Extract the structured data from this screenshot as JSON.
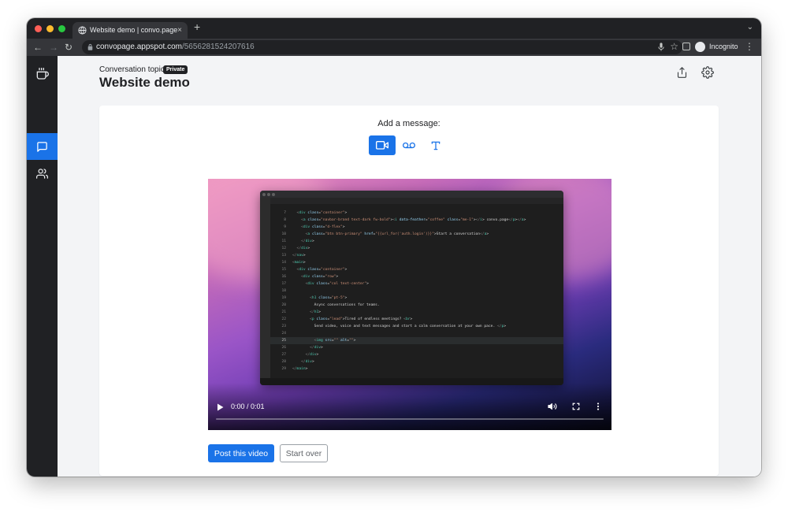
{
  "browser": {
    "tab_title": "Website demo | convo.page",
    "tab_close": "×",
    "new_tab": "+",
    "tab_search": "⌄",
    "url_host": "convopage.appspot.com",
    "url_path": "/5656281524207616",
    "profile_label": "Incognito",
    "menu": "⋮",
    "star": "☆",
    "back": "←",
    "forward": "→",
    "reload": "↻",
    "traffic_colors": [
      "#ff5f57",
      "#febc2e",
      "#28c840"
    ]
  },
  "app": {
    "logo": "coffee-cup-icon",
    "sidebar": [
      {
        "icon": "message-square-icon",
        "active": true
      },
      {
        "icon": "users-icon",
        "active": false
      }
    ],
    "header": {
      "topic_label": "Conversation topic:",
      "badge": "Private",
      "title": "Website demo"
    },
    "composer": {
      "add_label": "Add a message:",
      "modes": [
        {
          "icon": "video-icon",
          "active": true
        },
        {
          "icon": "voicemail-icon",
          "active": false
        },
        {
          "icon": "type-icon",
          "active": false
        }
      ],
      "video": {
        "time": "0:00 / 0:01",
        "code_lines": [
          {
            "n": "7",
            "code": "  <div class=\"container\">"
          },
          {
            "n": "8",
            "code": "    <a class=\"navbar-brand text-dark fw-bold\"><i data-feather=\"coffee\" class=\"me-1\"></i> convo.page</p></a>"
          },
          {
            "n": "9",
            "code": "    <div class=\"d-flex\">"
          },
          {
            "n": "10",
            "code": "      <a class=\"btn btn-primary\" href=\"{{url_for('auth.login')}}\">Start a conversation</a>"
          },
          {
            "n": "11",
            "code": "    </div>"
          },
          {
            "n": "12",
            "code": "  </div>"
          },
          {
            "n": "13",
            "code": "</nav>"
          },
          {
            "n": "14",
            "code": "<main>"
          },
          {
            "n": "15",
            "code": "  <div class=\"container\">"
          },
          {
            "n": "16",
            "code": "    <div class=\"row\">"
          },
          {
            "n": "17",
            "code": "      <div class=\"col text-center\">"
          },
          {
            "n": "18",
            "code": ""
          },
          {
            "n": "19",
            "code": "        <h1 class=\"pt-5\">"
          },
          {
            "n": "20",
            "code": "          Async conversations for teams."
          },
          {
            "n": "21",
            "code": "        </h1>"
          },
          {
            "n": "22",
            "code": "        <p class=\"lead\">Tired of endless meetings? <br>"
          },
          {
            "n": "23",
            "code": "          Send video, voice and text messages and start a calm conversation at your own pace. </p>"
          },
          {
            "n": "24",
            "code": ""
          },
          {
            "n": "25",
            "code": "          <img src=\"\" alt=\"\">",
            "active": true
          },
          {
            "n": "26",
            "code": "        </div>"
          },
          {
            "n": "27",
            "code": "      </div>"
          },
          {
            "n": "28",
            "code": "    </div>"
          },
          {
            "n": "29",
            "code": "</main>"
          }
        ]
      },
      "post_label": "Post this video",
      "start_over_label": "Start over"
    },
    "accent": "#1a73e8"
  }
}
